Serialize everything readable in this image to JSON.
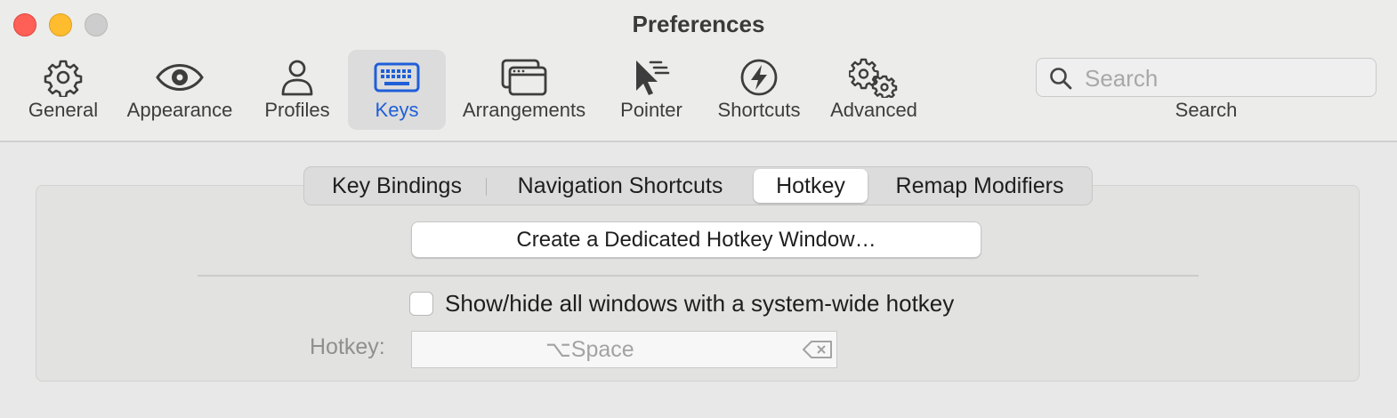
{
  "window": {
    "title": "Preferences",
    "buttons": {
      "close": "close",
      "minimize": "minimize",
      "zoom": "zoom"
    }
  },
  "toolbar": {
    "items": [
      {
        "label": "General",
        "icon": "gear-icon"
      },
      {
        "label": "Appearance",
        "icon": "eye-icon"
      },
      {
        "label": "Profiles",
        "icon": "person-icon"
      },
      {
        "label": "Keys",
        "icon": "keyboard-icon",
        "selected": true
      },
      {
        "label": "Arrangements",
        "icon": "windows-icon"
      },
      {
        "label": "Pointer",
        "icon": "pointer-icon"
      },
      {
        "label": "Shortcuts",
        "icon": "lightning-icon"
      },
      {
        "label": "Advanced",
        "icon": "gears-icon"
      }
    ],
    "search": {
      "placeholder": "Search",
      "label": "Search"
    }
  },
  "tabs": {
    "items": [
      "Key Bindings",
      "Navigation Shortcuts",
      "Hotkey",
      "Remap Modifiers"
    ],
    "active": "Hotkey"
  },
  "hotkey_pane": {
    "dedicated_button": "Create a Dedicated Hotkey Window…",
    "show_hide_checkbox": {
      "label": "Show/hide all windows with a system-wide hotkey",
      "checked": false
    },
    "hotkey_label": "Hotkey:",
    "hotkey_value": "⌥Space"
  },
  "colors": {
    "accent": "#1f5fd8",
    "close": "#fe5f57",
    "minimize": "#febc2e",
    "zoom_disabled": "#cdcdcd"
  }
}
